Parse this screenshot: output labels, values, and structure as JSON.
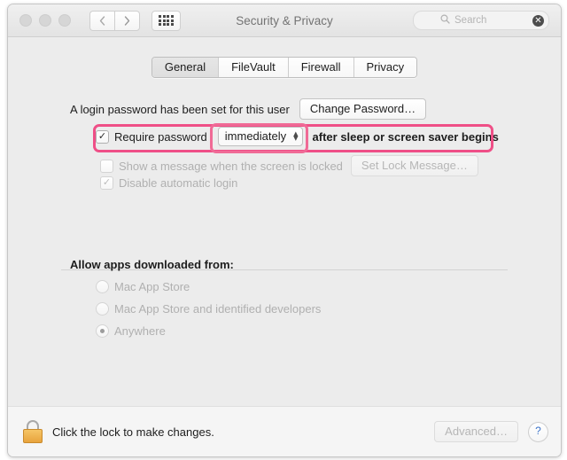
{
  "window": {
    "title": "Security & Privacy",
    "traffic_lights": [
      "close",
      "minimize",
      "zoom"
    ],
    "nav": {
      "back": "‹",
      "forward": "›"
    },
    "grid_button": "show-all-preferences"
  },
  "search": {
    "placeholder": "Search",
    "icon": "search-icon",
    "clear": "✕"
  },
  "tabs": [
    {
      "label": "General",
      "selected": true
    },
    {
      "label": "FileVault",
      "selected": false
    },
    {
      "label": "Firewall",
      "selected": false
    },
    {
      "label": "Privacy",
      "selected": false
    }
  ],
  "general": {
    "password_status": "A login password has been set for this user",
    "change_password_button": "Change Password…",
    "require_password": {
      "checkbox_checked": "✓",
      "label": "Require password",
      "delay_value": "immediately",
      "trailing_label": "after sleep or screen saver begins"
    },
    "lock_message": {
      "label": "Show a message when the screen is locked",
      "button": "Set Lock Message…"
    },
    "disable_auto_login": {
      "checkbox_checked": "✓",
      "label": "Disable automatic login"
    },
    "allow_apps_heading": "Allow apps downloaded from:",
    "allow_apps_options": [
      {
        "label": "Mac App Store",
        "selected": false
      },
      {
        "label": "Mac App Store and identified developers",
        "selected": false
      },
      {
        "label": "Anywhere",
        "selected": true
      }
    ]
  },
  "bottom": {
    "lock_text": "Click the lock to make changes.",
    "advanced_button": "Advanced…",
    "help_button": "?"
  },
  "colors": {
    "highlight": "#ef4f87",
    "lock": "#e8a33c",
    "help": "#3d74c9"
  }
}
